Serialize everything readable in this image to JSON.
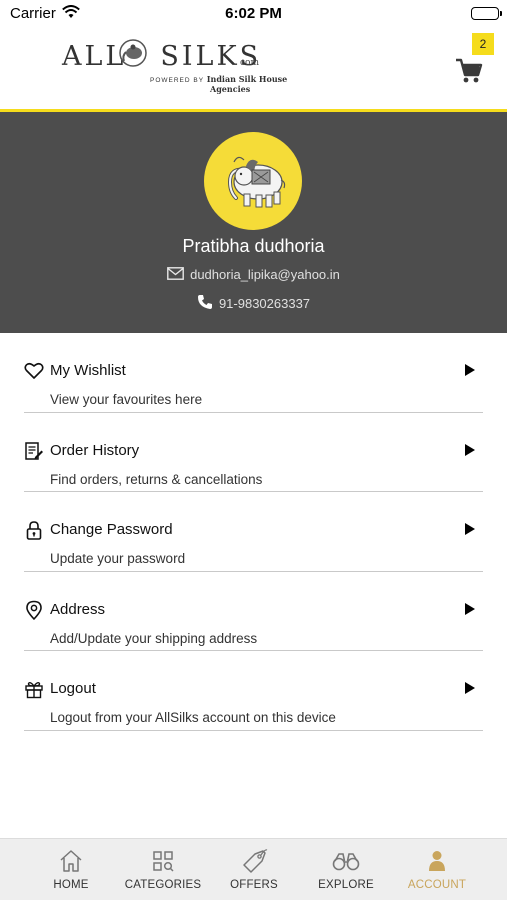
{
  "status_bar": {
    "carrier": "Carrier",
    "time": "6:02 PM"
  },
  "header": {
    "logo": {
      "all": "ALL",
      "silks": "SILKS",
      "com": "com",
      "powered_by": "POWERED BY",
      "company": "Indian Silk House",
      "agencies": "Agencies"
    },
    "cart": {
      "icon": "cart-icon",
      "badge_count": "2"
    }
  },
  "profile": {
    "name": "Pratibha dudhoria",
    "email": "dudhoria_lipika@yahoo.in",
    "phone": "91-9830263337",
    "avatar_icon": "elephant-icon"
  },
  "menu": {
    "items": [
      {
        "title": "My Wishlist",
        "subtitle": "View your favourites here",
        "icon": "heart-icon"
      },
      {
        "title": "Order History",
        "subtitle": "Find orders, returns & cancellations",
        "icon": "order-history-icon"
      },
      {
        "title": "Change Password",
        "subtitle": "Update your password",
        "icon": "lock-icon"
      },
      {
        "title": "Address",
        "subtitle": "Add/Update your shipping address",
        "icon": "location-pin-icon"
      },
      {
        "title": "Logout",
        "subtitle": "Logout from your AllSilks account on this device",
        "icon": "gift-icon"
      }
    ]
  },
  "tabbar": {
    "tabs": [
      {
        "label": "HOME",
        "icon": "home-icon"
      },
      {
        "label": "CATEGORIES",
        "icon": "categories-icon"
      },
      {
        "label": "OFFERS",
        "icon": "tag-icon"
      },
      {
        "label": "EXPLORE",
        "icon": "binoculars-icon"
      },
      {
        "label": "ACCOUNT",
        "icon": "person-icon",
        "active": true
      }
    ]
  },
  "colors": {
    "accent_yellow": "#f5dc1c",
    "banner_gray": "#4d4d4d",
    "active_tab_gold": "#c9a55c"
  }
}
